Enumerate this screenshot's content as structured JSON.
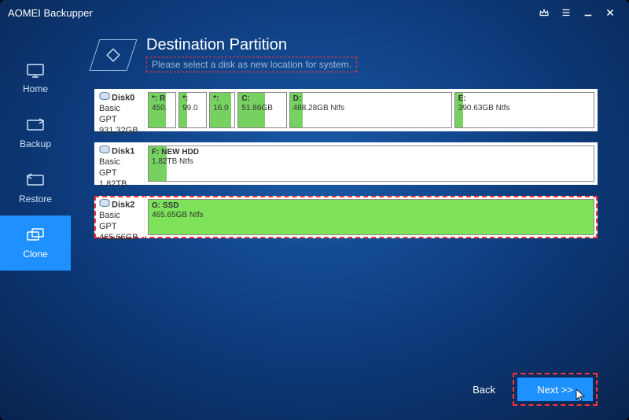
{
  "app": {
    "title": "AOMEI Backupper"
  },
  "sidebar": {
    "items": [
      {
        "label": "Home"
      },
      {
        "label": "Backup"
      },
      {
        "label": "Restore"
      },
      {
        "label": "Clone"
      }
    ],
    "active_index": 3
  },
  "header": {
    "title": "Destination Partition",
    "subtitle": "Please select a disk as new location for system."
  },
  "disks": [
    {
      "name": "Disk0",
      "scheme": "Basic GPT",
      "size": "931.32GB",
      "selected": false,
      "partitions": [
        {
          "label": "*: R",
          "detail": "450.",
          "flex": 0.45,
          "used_pct": 65
        },
        {
          "label": "*:",
          "detail": "99.0",
          "flex": 0.45,
          "used_pct": 30
        },
        {
          "label": "*:",
          "detail": "16.0",
          "flex": 0.4,
          "used_pct": 85
        },
        {
          "label": "C:",
          "detail": "51.86GB",
          "flex": 0.9,
          "used_pct": 55
        },
        {
          "label": "D:",
          "detail": "488.28GB Ntfs",
          "flex": 3.4,
          "used_pct": 8
        },
        {
          "label": "E:",
          "detail": "390.63GB Ntfs",
          "flex": 2.9,
          "used_pct": 6
        }
      ]
    },
    {
      "name": "Disk1",
      "scheme": "Basic GPT",
      "size": "1.82TB",
      "selected": false,
      "partitions": [
        {
          "label": "F: NEW HDD",
          "detail": "1.82TB Ntfs",
          "flex": 1,
          "used_pct": 4
        }
      ]
    },
    {
      "name": "Disk2",
      "scheme": "Basic GPT",
      "size": "465.66GB",
      "selected": true,
      "partitions": [
        {
          "label": "G: SSD",
          "detail": "465.65GB Ntfs",
          "flex": 1,
          "used_pct": 100,
          "selected": true
        }
      ]
    }
  ],
  "footer": {
    "back": "Back",
    "next": "Next >>"
  }
}
